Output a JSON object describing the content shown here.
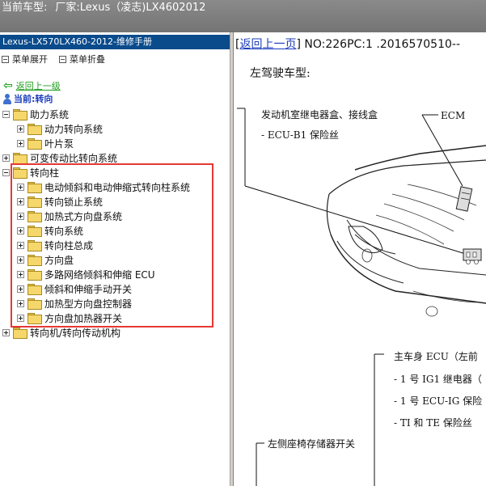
{
  "titlebar": {
    "label": "当前车型:",
    "manufacturer": "厂家:Lexus（凌志)LX4602012"
  },
  "left": {
    "header": "Lexus-LX570LX460-2012-维修手册",
    "expand_label": "菜单展开",
    "collapse_label": "菜单折叠",
    "back_label": "返回上一级",
    "current_label": "当前:转向",
    "tree": [
      {
        "label": "助力系统",
        "state": "expanded",
        "level": 0
      },
      {
        "label": "动力转向系统",
        "state": "collapsed",
        "level": 1
      },
      {
        "label": "叶片泵",
        "state": "collapsed",
        "level": 1
      },
      {
        "label": "可变传动比转向系统",
        "state": "collapsed",
        "level": 0
      },
      {
        "label": "转向柱",
        "state": "expanded",
        "level": 0
      },
      {
        "label": "电动倾斜和电动伸缩式转向柱系统",
        "state": "collapsed",
        "level": 1
      },
      {
        "label": "转向锁止系统",
        "state": "collapsed",
        "level": 1
      },
      {
        "label": "加热式方向盘系统",
        "state": "collapsed",
        "level": 1
      },
      {
        "label": "转向系统",
        "state": "collapsed",
        "level": 1
      },
      {
        "label": "转向柱总成",
        "state": "collapsed",
        "level": 1
      },
      {
        "label": "方向盘",
        "state": "collapsed",
        "level": 1
      },
      {
        "label": "多路网络倾斜和伸缩 ECU",
        "state": "collapsed",
        "level": 1
      },
      {
        "label": "倾斜和伸缩手动开关",
        "state": "collapsed",
        "level": 1
      },
      {
        "label": "加热型方向盘控制器",
        "state": "collapsed",
        "level": 1
      },
      {
        "label": "方向盘加热器开关",
        "state": "collapsed",
        "level": 1
      },
      {
        "label": "转向机/转向传动机构",
        "state": "collapsed",
        "level": 0
      }
    ]
  },
  "doc": {
    "back_link": "返回上一页",
    "info": "NO:226PC:1 .2016570510--",
    "model": "左驾驶车型:",
    "labels": {
      "relay_box": "发动机室继电器盒、接线盒",
      "fuse": "- ECU-B1 保险丝",
      "ecm": "ECM",
      "main_ecu": "主车身 ECU（左前",
      "ig1": "- 1 号 IG1 继电器（",
      "ecu_ig": "- 1 号 ECU-IG 保险",
      "ti_te": "- TI 和 TE 保险丝",
      "seat_switch": "左侧座椅存储器开关"
    }
  },
  "colors": {
    "title_bg": "#7b7b7b",
    "panel_header": "#0a4b8c",
    "highlight": "#e53935",
    "link": "#1a3bbb",
    "back_link": "#1f9e1f"
  }
}
